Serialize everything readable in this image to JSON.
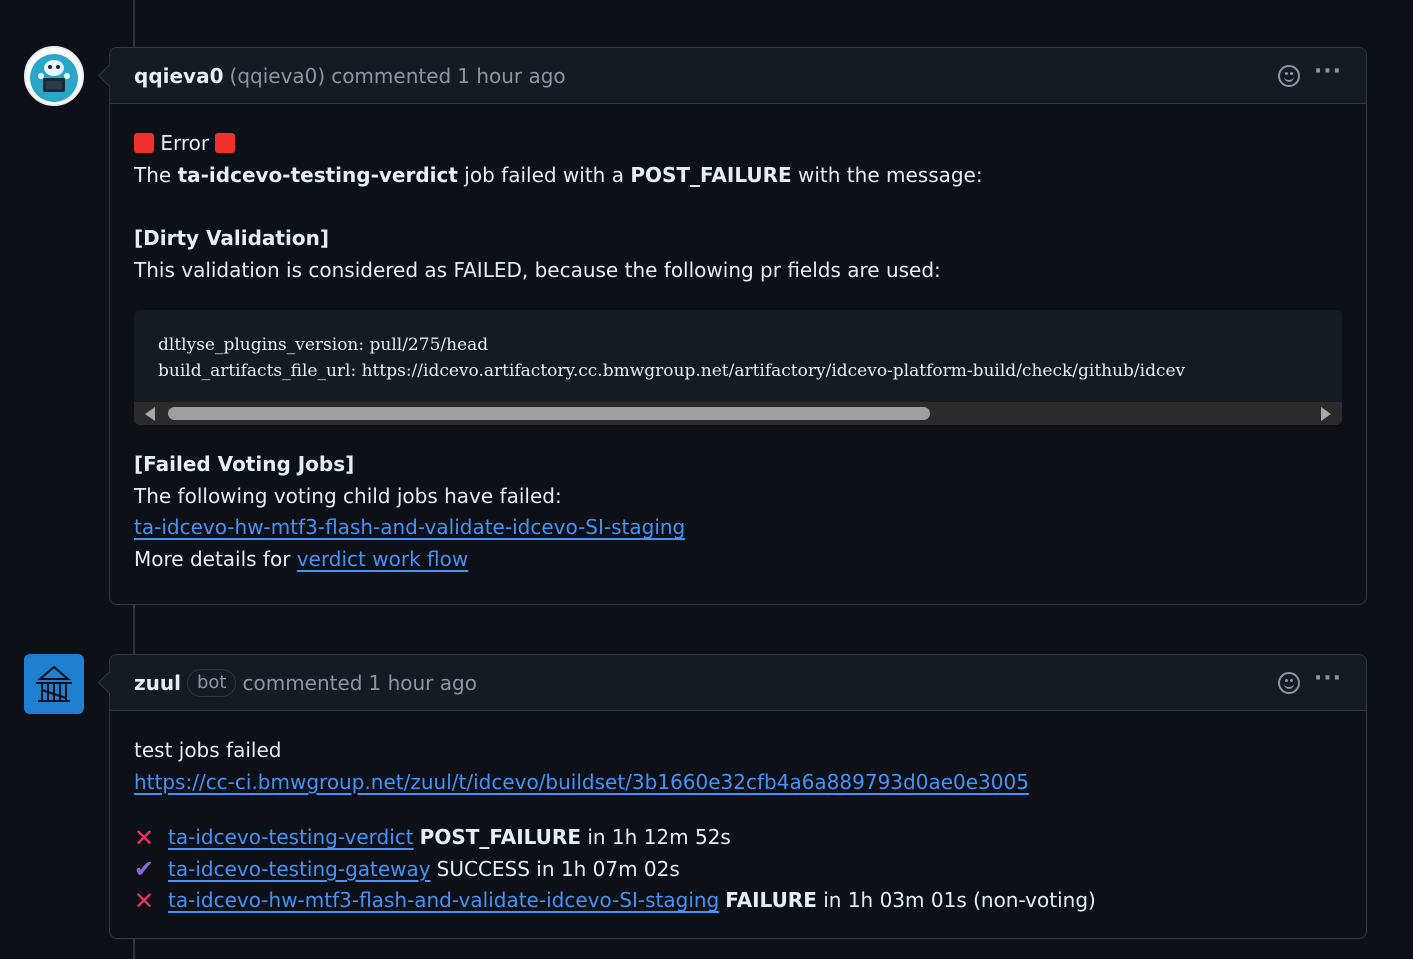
{
  "comments": [
    {
      "author": "qqieva0",
      "author_login": "(qqieva0)",
      "action": "commented",
      "time": "1 hour ago",
      "avatar_icon": "robot-avatar",
      "body": {
        "error_label": "Error",
        "sentence_prefix": "The ",
        "job_name": "ta-idcevo-testing-verdict",
        "sentence_mid": " job failed with a ",
        "failure_type": "POST_FAILURE",
        "sentence_suffix": " with the message:",
        "section1_title": "[Dirty Validation]",
        "section1_text": "This validation is considered as FAILED, because the following pr fields are used:",
        "code_lines": [
          "dltlyse_plugins_version: pull/275/head",
          "build_artifacts_file_url: https://idcevo.artifactory.cc.bmwgroup.net/artifactory/idcevo-platform-build/check/github/idcev"
        ],
        "section2_title": "[Failed Voting Jobs]",
        "section2_text": "The following voting child jobs have failed:",
        "failed_job_link": "ta-idcevo-hw-mtf3-flash-and-validate-idcevo-SI-staging",
        "details_prefix": "More details for ",
        "details_link": "verdict work flow"
      }
    },
    {
      "author": "zuul",
      "badge": "bot",
      "action": "commented",
      "time": "1 hour ago",
      "avatar_icon": "zuul-gate-avatar",
      "body": {
        "summary": "test jobs failed",
        "buildset_link": "https://cc-ci.bmwgroup.net/zuul/t/idcevo/buildset/3b1660e32cfb4a6a889793d0ae0e3005",
        "jobs": [
          {
            "status_icon": "x-icon",
            "name": "ta-idcevo-testing-verdict",
            "result": "POST_FAILURE",
            "duration": " in 1h 12m 52s"
          },
          {
            "status_icon": "check-icon",
            "name": "ta-idcevo-testing-gateway",
            "result": "SUCCESS",
            "duration": " in 1h 07m 02s"
          },
          {
            "status_icon": "x-icon",
            "name": "ta-idcevo-hw-mtf3-flash-and-validate-idcevo-SI-staging",
            "result": "FAILURE",
            "duration": " in 1h 03m 01s (non-voting)"
          }
        ]
      }
    }
  ],
  "colors": {
    "background": "#0d1117",
    "link": "#4493f8",
    "error_square": "#f0302a",
    "fail_icon": "#f0345d",
    "success_icon": "#8b65d8"
  }
}
